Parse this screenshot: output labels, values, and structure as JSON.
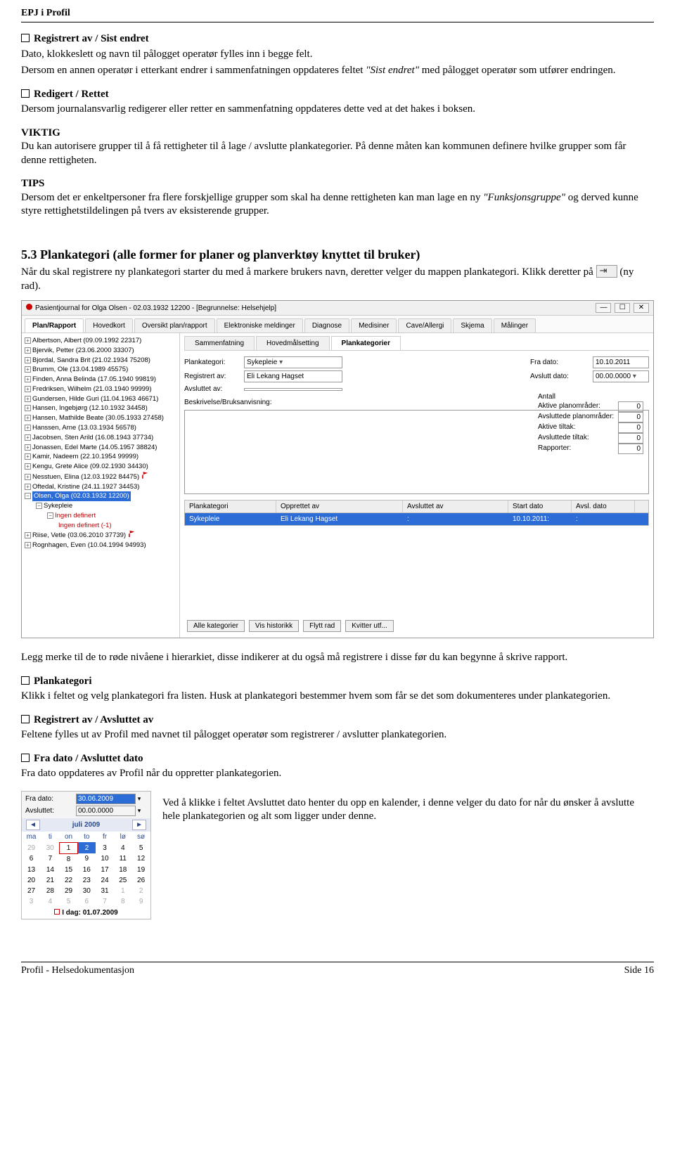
{
  "doc_header": "EPJ i Profil",
  "s1": {
    "title": "Registrert av / Sist endret",
    "p1": "Dato, klokkeslett og navn til pålogget operatør fylles inn i begge felt.",
    "p2a": "Dersom en annen operatør i etterkant endrer i sammenfatningen oppdateres feltet ",
    "p2i": "\"Sist endret\"",
    "p2b": " med pålogget operatør som utfører endringen."
  },
  "s2": {
    "title": "Redigert / Rettet",
    "p": "Dersom journalansvarlig redigerer eller retter en sammenfatning oppdateres dette ved at det hakes i boksen."
  },
  "s3": {
    "lead": "VIKTIG",
    "p": "Du kan autorisere grupper til å få rettigheter til å lage / avslutte plankategorier. På denne måten kan kommunen definere hvilke grupper som får denne rettigheten."
  },
  "s4": {
    "lead": "TIPS",
    "p1": "Dersom det er enkeltpersoner fra flere forskjellige grupper som skal ha denne rettigheten kan man lage en ny ",
    "pi": "\"Funksjonsgruppe\"",
    "p2": " og derved kunne styre rettighetstildelingen på tvers av eksisterende grupper."
  },
  "h53": "5.3 Plankategori (alle former for planer og planverktøy knyttet til bruker)",
  "h53p1": "Når du skal registrere ny plankategori starter du med å markere brukers navn, deretter velger du mappen plankategori. Klikk deretter på ",
  "h53p2": " (ny rad).",
  "window": {
    "title": "Pasientjournal for Olga Olsen - 02.03.1932 12200 - [Begrunnelse: Helsehjelp]",
    "tabs": [
      "Plan/Rapport",
      "Hovedkort",
      "Oversikt plan/rapport",
      "Elektroniske meldinger",
      "Diagnose",
      "Medisiner",
      "Cave/Allergi",
      "Skjema",
      "Målinger"
    ],
    "tree": [
      "Albertson, Albert (09.09.1992 22317)",
      "Bjervik, Petter (23.06.2000 33307)",
      "Bjordal, Sandra Brit (21.02.1934 75208)",
      "Brumm, Ole (13.04.1989 45575)",
      "Finden, Anna Belinda (17.05.1940 99819)",
      "Fredriksen, Wilhelm (21.03.1940 99999)",
      "Gundersen, Hilde Guri (11.04.1963 46671)",
      "Hansen, Ingebjørg (12.10.1932 34458)",
      "Hansen, Mathilde Beate (30.05.1933 27458)",
      "Hanssen, Arne (13.03.1934 56578)",
      "Jacobsen, Sten Arild (16.08.1943 37734)",
      "Jonassen, Edel Marte (14.05.1957 38824)",
      "Kamir, Nadeem (22.10.1954 99999)",
      "Kengu, Grete Alice (09.02.1930 34430)",
      "Nesstuen, Elina (12.03.1922 84475)",
      "Oftedal, Kristine (24.11.1927 34453)"
    ],
    "selected": "Olsen, Olga (02.03.1932 12200)",
    "sub1": "Sykepleie",
    "sub2": "Ingen definert",
    "sub3": "Ingen definert (-1)",
    "tree2": [
      "Riise, Vetle (03.06.2010 37739)",
      "Rognhagen, Even (10.04.1994 94993)"
    ],
    "subtabs": [
      "Sammenfatning",
      "Hovedmålsetting",
      "Plankategorier"
    ],
    "form": {
      "plankat_lbl": "Plankategori:",
      "plankat_val": "Sykepleie",
      "reg_lbl": "Registrert av:",
      "reg_val": "Eli Lekang Hagset",
      "avs_lbl": "Avsluttet av:",
      "fra_lbl": "Fra dato:",
      "fra_val": "10.10.2011",
      "avsdato_lbl": "Avslutt dato:",
      "avsdato_val": "00.00.0000",
      "besk_lbl": "Beskrivelse/Bruksanvisning:"
    },
    "counts_title": "Antall",
    "counts": [
      {
        "l": "Aktive planområder:",
        "v": "0"
      },
      {
        "l": "Avsluttede planområder:",
        "v": "0"
      },
      {
        "l": "Aktive tiltak:",
        "v": "0"
      },
      {
        "l": "Avsluttede tiltak:",
        "v": "0"
      },
      {
        "l": "Rapporter:",
        "v": "0"
      }
    ],
    "gridh": [
      "Plankategori",
      "Opprettet av",
      "Avsluttet av",
      "Start dato",
      "Avsl. dato"
    ],
    "gridrow": [
      "Sykepleie",
      "Eli Lekang Hagset",
      ":",
      "10.10.2011:",
      ":"
    ],
    "buttons": [
      "Alle kategorier",
      "Vis historikk",
      "Flytt rad",
      "Kvitter utf..."
    ]
  },
  "after_window": "Legg merke til de to røde nivåene i hierarkiet, disse indikerer at du også må registrere i disse før du kan begynne å skrive rapport.",
  "s5": {
    "title": "Plankategori",
    "p": "Klikk i feltet og velg plankategori fra listen. Husk at plankategori bestemmer hvem som får se det som dokumenteres under plankategorien."
  },
  "s6": {
    "title": "Registrert av / Avsluttet av",
    "p": "Feltene fylles ut av Profil med navnet til pålogget operatør som registrerer / avslutter plankategorien."
  },
  "s7": {
    "title": "Fra dato / Avsluttet dato",
    "p": "Fra dato oppdateres av Profil når du oppretter plankategorien."
  },
  "cal": {
    "fra_lbl": "Fra dato:",
    "fra_val": "30.06.2009",
    "avs_lbl": "Avsluttet:",
    "avs_val": "00.00.0000",
    "month": "juli 2009",
    "days": [
      "ma",
      "ti",
      "on",
      "to",
      "fr",
      "lø",
      "sø"
    ],
    "wk0": [
      "29",
      "30",
      "1",
      "2",
      "3",
      "4",
      "5"
    ],
    "wk1": [
      "6",
      "7",
      "8",
      "9",
      "10",
      "11",
      "12"
    ],
    "wk2": [
      "13",
      "14",
      "15",
      "16",
      "17",
      "18",
      "19"
    ],
    "wk3": [
      "20",
      "21",
      "22",
      "23",
      "24",
      "25",
      "26"
    ],
    "wk4": [
      "27",
      "28",
      "29",
      "30",
      "31",
      "1",
      "2"
    ],
    "wk5": [
      "3",
      "4",
      "5",
      "6",
      "7",
      "8",
      "9"
    ],
    "today": "I dag: 01.07.2009"
  },
  "cal_para": "Ved å klikke i feltet Avsluttet dato henter du opp en kalender, i denne velger du dato for når du ønsker å avslutte hele plankategorien og alt som ligger under denne.",
  "footer_left": "Profil - Helsedokumentasjon",
  "footer_right": "Side 16"
}
